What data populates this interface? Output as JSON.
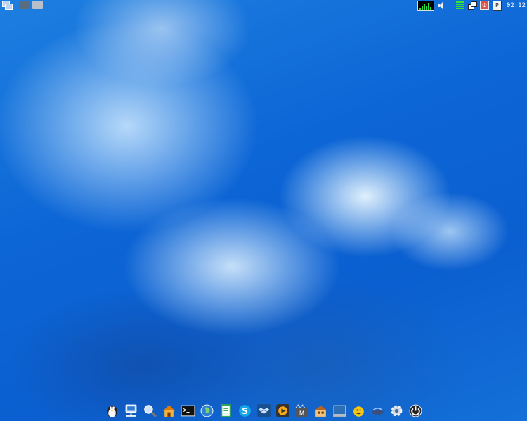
{
  "top_panel": {
    "workspaces": [
      "workspace-1",
      "workspace-2"
    ]
  },
  "tray": {
    "clock": "02:12",
    "power_label": "P"
  },
  "dock": {
    "items": [
      "mascot-icon",
      "network-icon",
      "search-icon",
      "home-icon",
      "terminal-icon",
      "browser-icon",
      "document-icon",
      "skype-icon",
      "dropbox-icon",
      "media-player-icon",
      "video-editor-icon",
      "package-manager-icon",
      "drive-icon",
      "chat-icon",
      "wireless-icon",
      "settings-icon",
      "power-icon"
    ]
  },
  "colors": {
    "accent": "#0b5fd0",
    "tray_green": "#37e62f"
  }
}
